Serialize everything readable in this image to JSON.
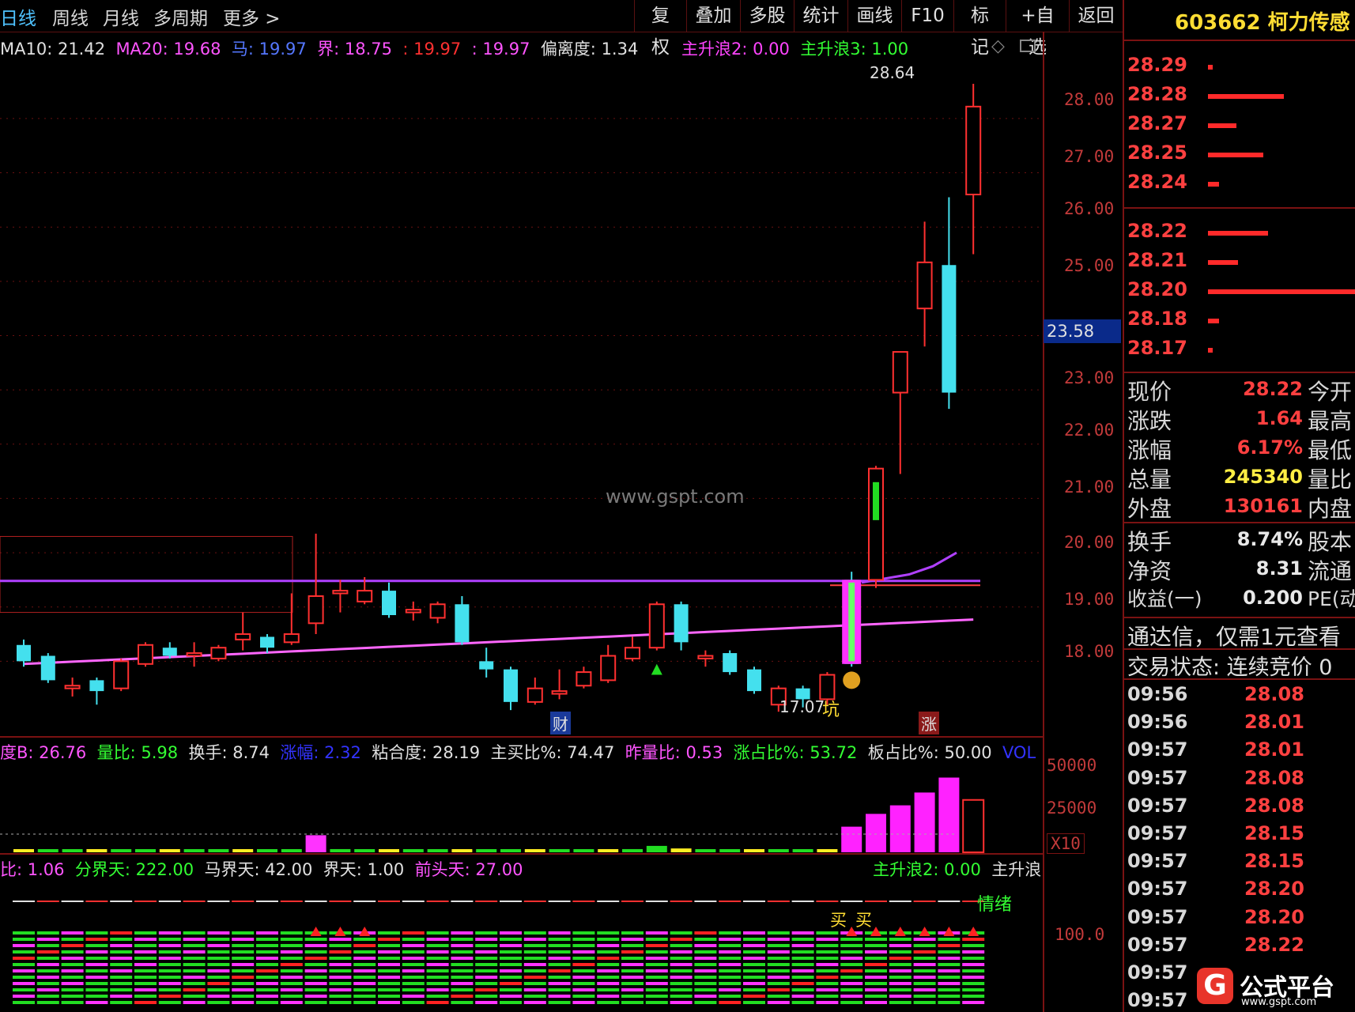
{
  "tabs": [
    "日线",
    "周线",
    "月线",
    "多周期",
    "更多 >"
  ],
  "toolbar": [
    "复权",
    "叠加",
    "多股",
    "统计",
    "画线",
    "F10",
    "标记",
    "+自选",
    "返回"
  ],
  "stock_header": "603662 柯力传感",
  "main_indicators": [
    {
      "text": "MA10: 21.42",
      "color": "#e0e0e0"
    },
    {
      "text": "MA20: 19.68",
      "color": "#ff55ff"
    },
    {
      "text": "马: 19.97",
      "color": "#5577ff"
    },
    {
      "text": "界: 18.75",
      "color": "#ff55ff"
    },
    {
      "text": ": 19.97",
      "color": "#ff3030"
    },
    {
      "text": ": 19.97",
      "color": "#ff55ff"
    },
    {
      "text": "偏离度: 1.34",
      "color": "#e0e0e0"
    }
  ],
  "wave_labels": [
    {
      "text": "主升浪2: 0.00",
      "color": "#ff44ff"
    },
    {
      "text": "主升浪3: 1.00",
      "color": "#33ff33"
    }
  ],
  "price_axis": [
    "28.00",
    "27.00",
    "26.00",
    "25.00",
    "23.00",
    "22.00",
    "21.00",
    "20.00",
    "19.00",
    "18.00"
  ],
  "current_price_tag": "23.58",
  "max_label": "28.64",
  "min_label": "17.07",
  "pit_label": "坑",
  "watermark": "www.gspt.com",
  "markers": {
    "cai": "财",
    "zhang": "涨"
  },
  "vol_indicators": [
    {
      "text": "度B: 26.76",
      "color": "#ff55ff"
    },
    {
      "text": "量比: 5.98",
      "color": "#33ff33"
    },
    {
      "text": "换手: 8.74",
      "color": "#e0e0e0"
    },
    {
      "text": "涨幅: 2.32",
      "color": "#3333ff"
    },
    {
      "text": "粘合度: 28.19",
      "color": "#e0e0e0"
    },
    {
      "text": "主买比%: 74.47",
      "color": "#e0e0e0"
    },
    {
      "text": "昨量比: 0.53",
      "color": "#ff55ff"
    },
    {
      "text": "涨占比%: 53.72",
      "color": "#33ff33"
    },
    {
      "text": "板占比%: 50.00",
      "color": "#e0e0e0"
    },
    {
      "text": "VOL",
      "color": "#3333ff"
    }
  ],
  "vol_axis": [
    "50000",
    "25000"
  ],
  "vol_unit": "X10",
  "sub_indicators": [
    {
      "text": "比: 1.06",
      "color": "#ff55ff"
    },
    {
      "text": "分界天: 222.00",
      "color": "#33ff33"
    },
    {
      "text": "马界天: 42.00",
      "color": "#e0e0e0"
    },
    {
      "text": "界天: 1.00",
      "color": "#e0e0e0"
    },
    {
      "text": "前头天: 27.00",
      "color": "#ff55ff"
    }
  ],
  "sub_wave_labels": [
    {
      "text": "主升浪2: 0.00",
      "color": "#33ff33"
    },
    {
      "text": "主升浪",
      "color": "#e0e0e0"
    }
  ],
  "sub_axis": "100.0",
  "sentiment_label": "情绪",
  "buy_labels": [
    "买",
    "买"
  ],
  "order_book": {
    "asks": [
      {
        "price": "28.29",
        "bar": 6
      },
      {
        "price": "28.28",
        "bar": 96
      },
      {
        "price": "28.27",
        "bar": 36
      },
      {
        "price": "28.25",
        "bar": 70
      },
      {
        "price": "28.24",
        "bar": 14
      }
    ],
    "bids": [
      {
        "price": "28.22",
        "bar": 76
      },
      {
        "price": "28.21",
        "bar": 38
      },
      {
        "price": "28.20",
        "bar": 190
      },
      {
        "price": "28.18",
        "bar": 14
      },
      {
        "price": "28.17",
        "bar": 6
      }
    ]
  },
  "stats": [
    {
      "label": "现价",
      "value": "28.22",
      "color": "#ff4040",
      "label2": "今开"
    },
    {
      "label": "涨跌",
      "value": "1.64",
      "color": "#ff4040",
      "label2": "最高"
    },
    {
      "label": "涨幅",
      "value": "6.17%",
      "color": "#ff4040",
      "label2": "最低"
    },
    {
      "label": "总量",
      "value": "245340",
      "color": "#ffee44",
      "label2": "量比"
    },
    {
      "label": "外盘",
      "value": "130161",
      "color": "#ff4040",
      "label2": "内盘"
    }
  ],
  "stats2": [
    {
      "label": "换手",
      "value": "8.74%",
      "color": "#e8e8e8",
      "label2": "股本"
    },
    {
      "label": "净资",
      "value": "8.31",
      "color": "#e8e8e8",
      "label2": "流通"
    },
    {
      "label": "收益(一)",
      "value": "0.200",
      "color": "#e8e8e8",
      "label2": "PE(动"
    }
  ],
  "promo": "通达信，仅需1元查看",
  "trade_status": "交易状态: 连续竞价 0",
  "ticks": [
    {
      "time": "09:56",
      "price": "28.08"
    },
    {
      "time": "09:56",
      "price": "28.01"
    },
    {
      "time": "09:57",
      "price": "28.01"
    },
    {
      "time": "09:57",
      "price": "28.08"
    },
    {
      "time": "09:57",
      "price": "28.08"
    },
    {
      "time": "09:57",
      "price": "28.15"
    },
    {
      "time": "09:57",
      "price": "28.15"
    },
    {
      "time": "09:57",
      "price": "28.20"
    },
    {
      "time": "09:57",
      "price": "28.20"
    },
    {
      "time": "09:57",
      "price": "28.22"
    },
    {
      "time": "09:57",
      "price": ""
    },
    {
      "time": "09:57",
      "price": ""
    }
  ],
  "logo": {
    "name": "公式平台",
    "url": "www.gspt.com"
  },
  "chart_data": {
    "type": "candlestick",
    "y_axis": {
      "min": 17.0,
      "max": 28.8
    },
    "candles": [
      {
        "o": 18.3,
        "c": 18.0,
        "h": 18.4,
        "l": 17.9
      },
      {
        "o": 18.1,
        "c": 17.65,
        "h": 18.15,
        "l": 17.6
      },
      {
        "o": 17.5,
        "c": 17.55,
        "h": 17.7,
        "l": 17.35
      },
      {
        "o": 17.65,
        "c": 17.45,
        "h": 17.7,
        "l": 17.2
      },
      {
        "o": 17.5,
        "c": 18.0,
        "h": 18.05,
        "l": 17.45
      },
      {
        "o": 17.95,
        "c": 18.3,
        "h": 18.35,
        "l": 17.9
      },
      {
        "o": 18.25,
        "c": 18.1,
        "h": 18.35,
        "l": 18.05
      },
      {
        "o": 18.1,
        "c": 18.15,
        "h": 18.35,
        "l": 17.9
      },
      {
        "o": 18.05,
        "c": 18.25,
        "h": 18.3,
        "l": 18.0
      },
      {
        "o": 18.4,
        "c": 18.5,
        "h": 18.9,
        "l": 18.2
      },
      {
        "o": 18.45,
        "c": 18.25,
        "h": 18.5,
        "l": 18.15
      },
      {
        "o": 18.35,
        "c": 18.5,
        "h": 19.25,
        "l": 18.3
      },
      {
        "o": 18.7,
        "c": 19.2,
        "h": 20.35,
        "l": 18.5
      },
      {
        "o": 19.25,
        "c": 19.3,
        "h": 19.5,
        "l": 18.9
      },
      {
        "o": 19.1,
        "c": 19.3,
        "h": 19.55,
        "l": 19.05
      },
      {
        "o": 19.3,
        "c": 18.85,
        "h": 19.45,
        "l": 18.8
      },
      {
        "o": 18.9,
        "c": 18.95,
        "h": 19.1,
        "l": 18.75
      },
      {
        "o": 18.8,
        "c": 19.05,
        "h": 19.1,
        "l": 18.7
      },
      {
        "o": 19.05,
        "c": 18.35,
        "h": 19.2,
        "l": 18.3
      },
      {
        "o": 18.0,
        "c": 17.85,
        "h": 18.25,
        "l": 17.7
      },
      {
        "o": 17.85,
        "c": 17.25,
        "h": 17.9,
        "l": 17.1
      },
      {
        "o": 17.25,
        "c": 17.5,
        "h": 17.7,
        "l": 17.2
      },
      {
        "o": 17.4,
        "c": 17.45,
        "h": 17.85,
        "l": 17.3
      },
      {
        "o": 17.55,
        "c": 17.8,
        "h": 17.9,
        "l": 17.5
      },
      {
        "o": 17.65,
        "c": 18.1,
        "h": 18.3,
        "l": 17.6
      },
      {
        "o": 18.05,
        "c": 18.25,
        "h": 18.45,
        "l": 18.0
      },
      {
        "o": 18.25,
        "c": 19.05,
        "h": 19.1,
        "l": 18.2
      },
      {
        "o": 19.05,
        "c": 18.35,
        "h": 19.1,
        "l": 18.2
      },
      {
        "o": 18.05,
        "c": 18.1,
        "h": 18.2,
        "l": 17.9
      },
      {
        "o": 18.15,
        "c": 17.8,
        "h": 18.2,
        "l": 17.75
      },
      {
        "o": 17.85,
        "c": 17.45,
        "h": 17.9,
        "l": 17.4
      },
      {
        "o": 17.2,
        "c": 17.5,
        "h": 17.55,
        "l": 17.07
      },
      {
        "o": 17.5,
        "c": 17.3,
        "h": 17.55,
        "l": 17.15
      },
      {
        "o": 17.3,
        "c": 17.75,
        "h": 17.8,
        "l": 17.2
      },
      {
        "o": 19.5,
        "c": 17.95,
        "h": 19.65,
        "l": 17.9
      },
      {
        "o": 19.5,
        "c": 21.55,
        "h": 21.6,
        "l": 19.35
      },
      {
        "o": 22.95,
        "c": 23.7,
        "h": 23.7,
        "l": 21.45
      },
      {
        "o": 24.5,
        "c": 25.35,
        "h": 26.1,
        "l": 23.8
      },
      {
        "o": 25.3,
        "c": 22.95,
        "h": 26.55,
        "l": 22.65
      },
      {
        "o": 26.6,
        "c": 28.22,
        "h": 28.64,
        "l": 25.5
      }
    ],
    "volume": [
      900,
      700,
      600,
      800,
      500,
      600,
      700,
      800,
      900,
      1000,
      800,
      900,
      8000,
      1500,
      1400,
      1200,
      1000,
      900,
      1100,
      1200,
      900,
      800,
      900,
      1000,
      1100,
      1500,
      3000,
      1800,
      1200,
      1000,
      900,
      800,
      900,
      1000,
      12000,
      18000,
      22000,
      28000,
      35000,
      24540
    ]
  }
}
